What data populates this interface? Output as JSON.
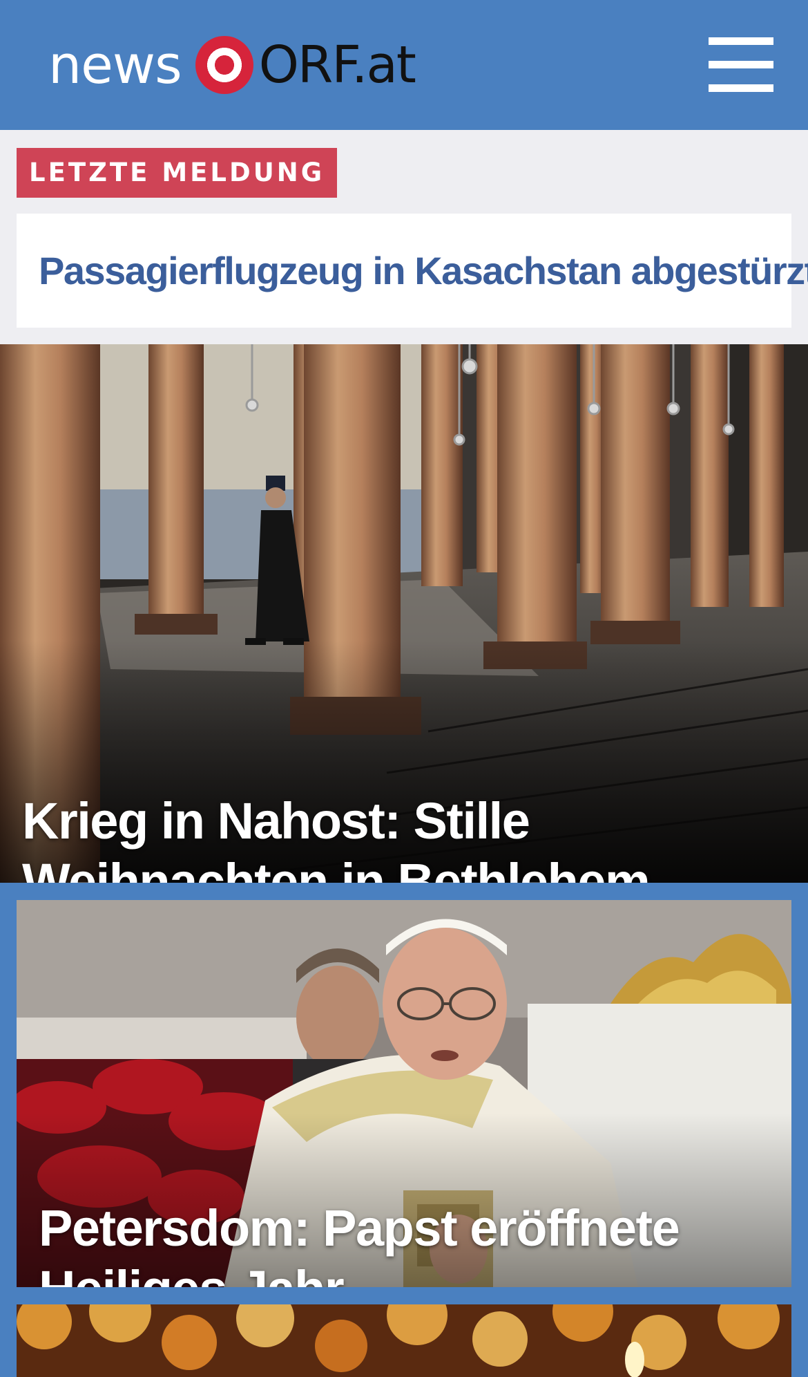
{
  "header": {
    "logo_news": "news",
    "logo_orf": "ORF.at",
    "menu_icon": "hamburger-menu-icon"
  },
  "breaking": {
    "badge_label": "LETZTE MELDUNG",
    "headline": "Passagierflugzeug in Kasachstan abgestürzt"
  },
  "stories": [
    {
      "title": "Krieg in Nahost: Stille Weihnachten in Bethlehem"
    },
    {
      "title": "Petersdom: Papst eröffnete Heiliges Jahr"
    }
  ],
  "colors": {
    "brand_blue": "#4a80c0",
    "orf_red": "#d6243b",
    "badge_red": "#cf4456",
    "headline_blue": "#3b5e9b",
    "breaking_bg": "#eeeef2"
  }
}
